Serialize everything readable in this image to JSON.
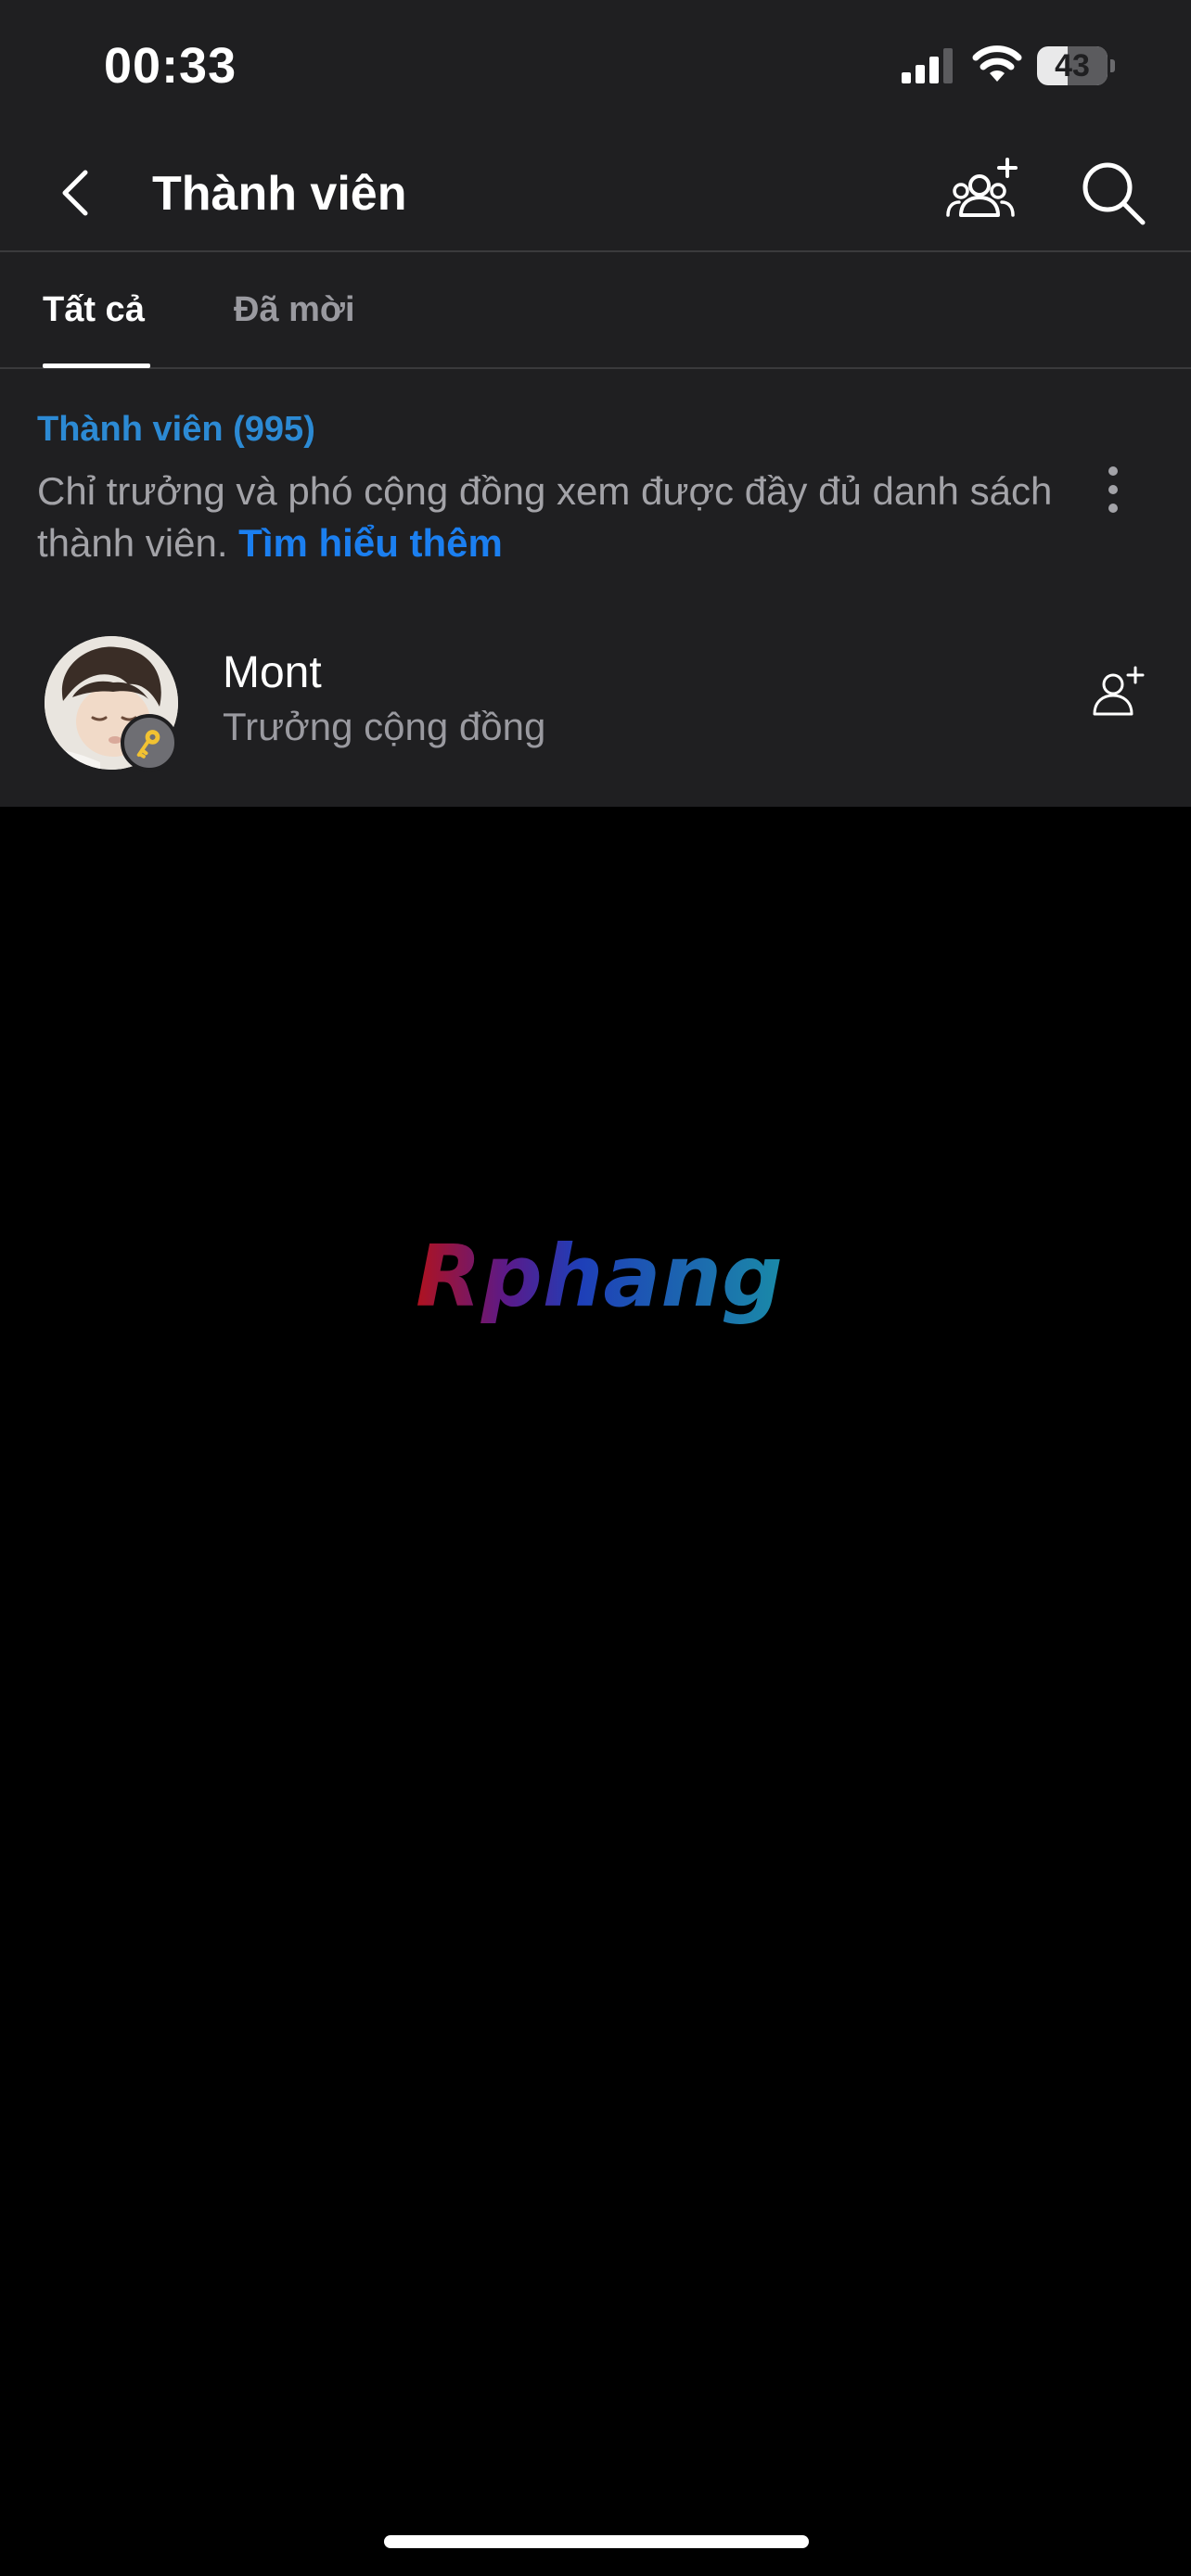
{
  "status_bar": {
    "time": "00:33",
    "battery": "43"
  },
  "header": {
    "title": "Thành viên",
    "back_icon": "chevron-left-icon",
    "add_member_icon": "people-add-icon",
    "search_icon": "search-icon"
  },
  "tabs": [
    {
      "label": "Tất cả",
      "active": true
    },
    {
      "label": "Đã mời",
      "active": false
    }
  ],
  "members_section": {
    "heading": "Thành viên (995)",
    "description": "Chỉ trưởng và phó cộng đồng xem được đầy đủ danh sách thành viên.",
    "learn_more": "Tìm hiểu thêm",
    "more_icon": "more-vertical-icon",
    "members": [
      {
        "name": "Mont",
        "role": "Trưởng cộng đồng",
        "badge_icon": "key-icon",
        "action_icon": "person-add-icon"
      }
    ]
  },
  "watermark": {
    "text": "Rphang"
  },
  "colors": {
    "surface": "#1f1f21",
    "background": "#000000",
    "link_blue": "#1b7ff0",
    "heading_blue": "#2c8ad4",
    "secondary_text": "#9a9aa0"
  }
}
